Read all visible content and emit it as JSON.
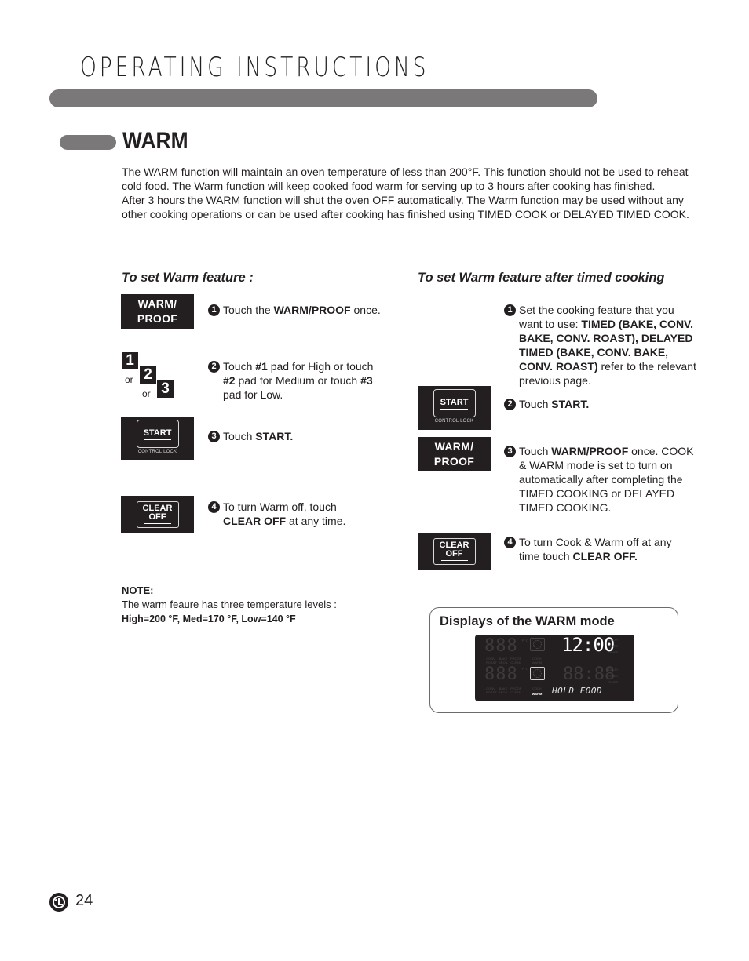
{
  "header": {
    "title": "OPERATING INSTRUCTIONS"
  },
  "section": {
    "title": "WARM",
    "intro": [
      "The WARM function will maintain an oven temperature of less than 200°F. This function should not be used to reheat cold food. The Warm function will keep cooked food warm for serving up to 3 hours after cooking has finished.",
      "After 3 hours the WARM function will shut the oven OFF automatically. The Warm function may be used without any other cooking operations or can be used after cooking has finished using TIMED COOK or DELAYED TIMED COOK."
    ]
  },
  "pads": {
    "warm_line1": "WARM/",
    "warm_line2": "PROOF",
    "start": "START",
    "control_lock": "CONTROL LOCK",
    "clear": "CLEAR",
    "off": "OFF",
    "num1": "1",
    "num2": "2",
    "num3": "3",
    "or": "or"
  },
  "left_column": {
    "heading": "To set Warm feature :",
    "steps": [
      {
        "num": "1",
        "pre": "Touch the ",
        "bold": "WARM/PROOF",
        "post": " once."
      },
      {
        "num": "2",
        "parts": [
          "Touch ",
          "#1",
          " pad for High or touch ",
          "#2",
          " pad for Medium or touch ",
          "#3",
          " pad for Low."
        ]
      },
      {
        "num": "3",
        "pre": "Touch ",
        "bold": "START.",
        "post": ""
      },
      {
        "num": "4",
        "pre": "To turn Warm off, touch ",
        "bold": "CLEAR OFF",
        "post": " at any time."
      }
    ]
  },
  "note": {
    "heading": "NOTE:",
    "text": "The warm feaure has three temperature levels :",
    "levels": "High=200 °F, Med=170 °F, Low=140 °F"
  },
  "right_column": {
    "heading": "To set Warm feature after timed cooking",
    "steps": [
      {
        "num": "1",
        "pre": "Set the cooking feature that you want to use: ",
        "bold": "TIMED (BAKE, CONV. BAKE, CONV. ROAST), DELAYED TIMED (BAKE, CONV. BAKE, CONV. ROAST)",
        "post": " refer to the relevant previous page."
      },
      {
        "num": "2",
        "pre": "Touch ",
        "bold": "START.",
        "post": ""
      },
      {
        "num": "3",
        "pre": "Touch ",
        "bold": "WARM/PROOF",
        "post": " once. COOK & WARM mode is set to turn on automatically after completing the TIMED COOKING or DELAYED TIMED COOKING."
      },
      {
        "num": "4",
        "pre": "To turn Cook & Warm off at any time touch ",
        "bold": "CLEAR OFF.",
        "post": ""
      }
    ]
  },
  "display_panel": {
    "title": "Displays of the WARM mode",
    "clock": "12:00",
    "message": "HOLD FOOD",
    "dim_digits_top": "888",
    "dim_digits_bottom": "888",
    "dim_timer_bottom": "88:88",
    "labels_top": [
      "CONV ROAST",
      "BAKE BROIL",
      "PROOF CLEAN",
      "COOK WARM"
    ],
    "labels_bottom": [
      "CONV ROAST",
      "BAKE BROIL",
      "PROOF CLEAN",
      "COOK"
    ],
    "active_label": "WARM",
    "side_labels": [
      "DELAY",
      "TIMED",
      "TIMER"
    ],
    "units": "°F °C"
  },
  "footer": {
    "logo": "LG",
    "page_number": "24"
  }
}
